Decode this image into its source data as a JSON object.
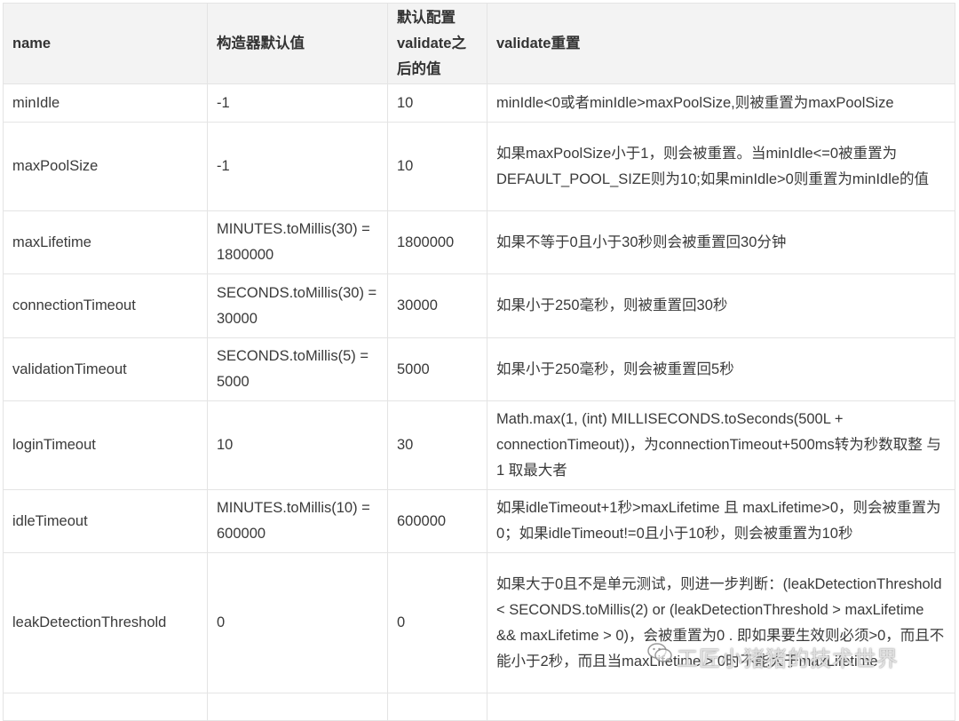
{
  "table": {
    "headers": [
      "name",
      "构造器默认值",
      "默认配置validate之后的值",
      "validate重置"
    ],
    "rows": [
      {
        "name": "minIdle",
        "constructor_default": "-1",
        "after_validate": "10",
        "validate_reset": "minIdle<0或者minIdle>maxPoolSize,则被重置为maxPoolSize"
      },
      {
        "name": "maxPoolSize",
        "constructor_default": "-1",
        "after_validate": "10",
        "validate_reset": "如果maxPoolSize小于1，则会被重置。当minIdle<=0被重置为DEFAULT_POOL_SIZE则为10;如果minIdle>0则重置为minIdle的值"
      },
      {
        "name": "maxLifetime",
        "constructor_default": "MINUTES.toMillis(30) = 1800000",
        "after_validate": "1800000",
        "validate_reset": "如果不等于0且小于30秒则会被重置回30分钟"
      },
      {
        "name": "connectionTimeout",
        "constructor_default": "SECONDS.toMillis(30) = 30000",
        "after_validate": "30000",
        "validate_reset": "如果小于250毫秒，则被重置回30秒"
      },
      {
        "name": "validationTimeout",
        "constructor_default": "SECONDS.toMillis(5) = 5000",
        "after_validate": "5000",
        "validate_reset": "如果小于250毫秒，则会被重置回5秒"
      },
      {
        "name": "loginTimeout",
        "constructor_default": "10",
        "after_validate": "30",
        "validate_reset": "Math.max(1, (int) MILLISECONDS.toSeconds(500L + connectionTimeout))，为connectionTimeout+500ms转为秒数取整 与 1 取最大者"
      },
      {
        "name": "idleTimeout",
        "constructor_default": "MINUTES.toMillis(10) = 600000",
        "after_validate": "600000",
        "validate_reset": "如果idleTimeout+1秒>maxLifetime 且 maxLifetime>0，则会被重置为0；如果idleTimeout!=0且小于10秒，则会被重置为10秒"
      },
      {
        "name": "leakDetectionThreshold",
        "constructor_default": "0",
        "after_validate": "0",
        "validate_reset": "如果大于0且不是单元测试，则进一步判断：(leakDetectionThreshold < SECONDS.toMillis(2) or (leakDetectionThreshold > maxLifetime && maxLifetime > 0)，会被重置为0 . 即如果要生效则必须>0，而且不能小于2秒，而且当maxLifetime > 0时不能大于maxLifetime"
      }
    ]
  },
  "watermark": {
    "icon": "wechat-icon",
    "text": "工匠小猪猪的技术世界"
  }
}
